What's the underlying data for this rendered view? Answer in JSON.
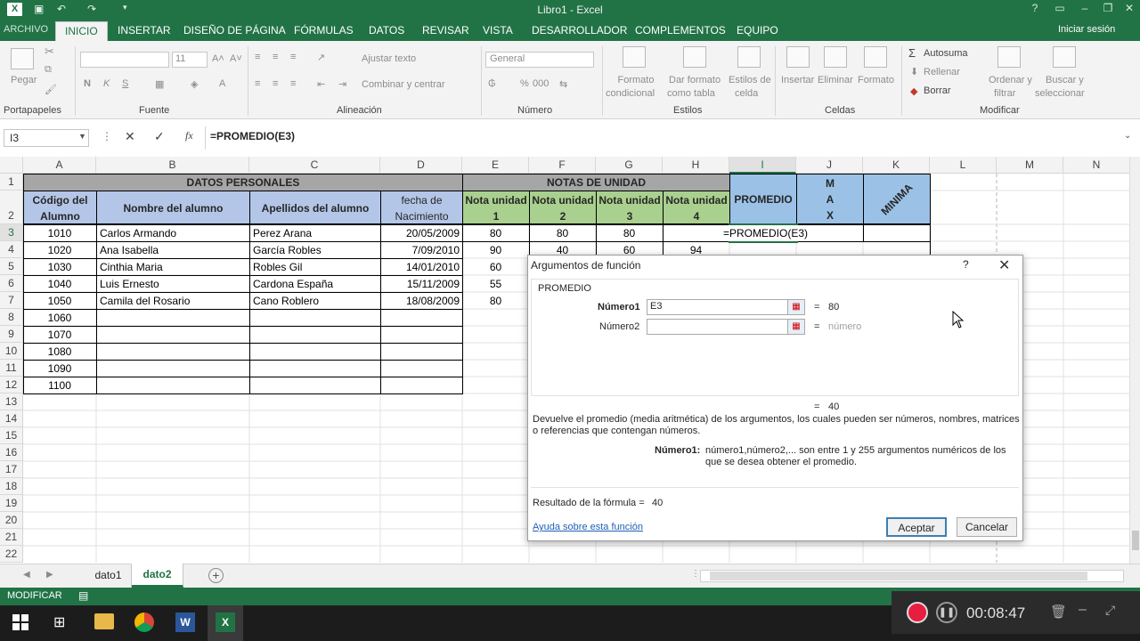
{
  "app": {
    "title": "Libro1 - Excel",
    "logo": "X",
    "signin": "Iniciar sesión",
    "tab_archivo": "ARCHIVO",
    "tabs": [
      "INICIO",
      "INSERTAR",
      "DISEÑO DE PÁGINA",
      "FÓRMULAS",
      "DATOS",
      "REVISAR",
      "VISTA",
      "DESARROLLADOR",
      "COMPLEMENTOS",
      "EQUIPO"
    ],
    "active_tab": "INICIO",
    "accent": "#217346"
  },
  "ribbon": {
    "clipboard": {
      "label": "Portapapeles",
      "paste": "Pegar"
    },
    "font": {
      "label": "Fuente",
      "size": "11",
      "bold": "N",
      "italic": "K",
      "underline": "S"
    },
    "align": {
      "label": "Alineación",
      "wrap": "Ajustar texto",
      "merge": "Combinar y centrar"
    },
    "number": {
      "label": "Número",
      "format": "General",
      "percent": "%",
      "thousands": "000"
    },
    "styles": {
      "label": "Estilos",
      "cond1": "Formato",
      "cond2": "condicional",
      "table1": "Dar formato",
      "table2": "como tabla",
      "cell1": "Estilos de",
      "cell2": "celda"
    },
    "cells": {
      "label": "Celdas",
      "insert": "Insertar",
      "delete": "Eliminar",
      "format": "Formato"
    },
    "edit": {
      "label": "Modificar",
      "autosum": "Autosuma",
      "fill": "Rellenar",
      "clear": "Borrar",
      "sort1": "Ordenar y",
      "sort2": "filtrar",
      "find1": "Buscar y",
      "find2": "seleccionar"
    }
  },
  "formula_bar": {
    "name_box": "I3",
    "formula": "=PROMEDIO(E3)"
  },
  "columns": [
    "A",
    "B",
    "C",
    "D",
    "E",
    "F",
    "G",
    "H",
    "I",
    "J",
    "K",
    "L",
    "M",
    "N"
  ],
  "rows": [
    "1",
    "2",
    "3",
    "4",
    "5",
    "6",
    "7",
    "8",
    "9",
    "10",
    "11",
    "12",
    "13",
    "14",
    "15",
    "16",
    "17",
    "18",
    "19",
    "20",
    "21",
    "22"
  ],
  "sheet": {
    "header1": {
      "datos": "DATOS PERSONALES",
      "notas": "NOTAS DE UNIDAD"
    },
    "header2": {
      "codigo": "Código del Alumno",
      "nombre": "Nombre del alumno",
      "apellidos": "Apellidos del alumno",
      "fecha": "fecha de Nacimiento",
      "n1": "Nota unidad 1",
      "n2": "Nota unidad 2",
      "n3": "Nota unidad 3",
      "n4": "Nota unidad 4",
      "promedio": "PROMEDIO",
      "max": "M\nA\nX",
      "min": "MINIMA"
    },
    "records": [
      {
        "codigo": "1010",
        "nombre": "Carlos Armando",
        "apellidos": "Perez Arana",
        "fecha": "20/05/2009",
        "n1": "80",
        "n2": "80",
        "n3": "80",
        "n4": ""
      },
      {
        "codigo": "1020",
        "nombre": "Ana Isabella",
        "apellidos": "García Robles",
        "fecha": "7/09/2010",
        "n1": "90",
        "n2": "40",
        "n3": "60",
        "n4": "94"
      },
      {
        "codigo": "1030",
        "nombre": "Cinthia Maria",
        "apellidos": "Robles Gil",
        "fecha": "14/01/2010",
        "n1": "60",
        "n2": "",
        "n3": "",
        "n4": ""
      },
      {
        "codigo": "1040",
        "nombre": "Luis Ernesto",
        "apellidos": "Cardona España",
        "fecha": "15/11/2009",
        "n1": "55",
        "n2": "",
        "n3": "",
        "n4": ""
      },
      {
        "codigo": "1050",
        "nombre": "Camila del Rosario",
        "apellidos": "Cano Roblero",
        "fecha": "18/08/2009",
        "n1": "80",
        "n2": "",
        "n3": "",
        "n4": ""
      }
    ],
    "codes_extra": [
      "1060",
      "1070",
      "1080",
      "1090",
      "1100"
    ],
    "active_cell_formula": "=PROMEDIO(E3)",
    "header_colors": {
      "personal": "#b4c6e7",
      "notas": "#a9d08e",
      "promedio": "#9bc2e6",
      "gray": "#a6a6a6"
    }
  },
  "dialog": {
    "title": "Argumentos de función",
    "help": "?",
    "func": "PROMEDIO",
    "arg1_label": "Número1",
    "arg1_value": "E3",
    "arg1_eq": "=",
    "arg1_result": "80",
    "arg2_label": "Número2",
    "arg2_eq": "=",
    "arg2_result": "número",
    "preview_eq": "=",
    "preview_value": "40",
    "desc": "Devuelve el promedio (media aritmética) de los argumentos, los cuales pueden ser números, nombres, matrices o referencias que contengan números.",
    "arg_desc_label": "Número1:",
    "arg_desc": "número1,número2,... son entre 1 y 255 argumentos numéricos de los que se desea obtener el promedio.",
    "result_label": "Resultado de la fórmula =",
    "result_value": "40",
    "help_link": "Ayuda sobre esta función",
    "ok": "Aceptar",
    "cancel": "Cancelar"
  },
  "sheet_tabs": [
    "dato1",
    "dato2"
  ],
  "active_sheet": "dato2",
  "status": {
    "mode": "MODIFICAR"
  },
  "recorder": {
    "time": "00:08:47"
  }
}
